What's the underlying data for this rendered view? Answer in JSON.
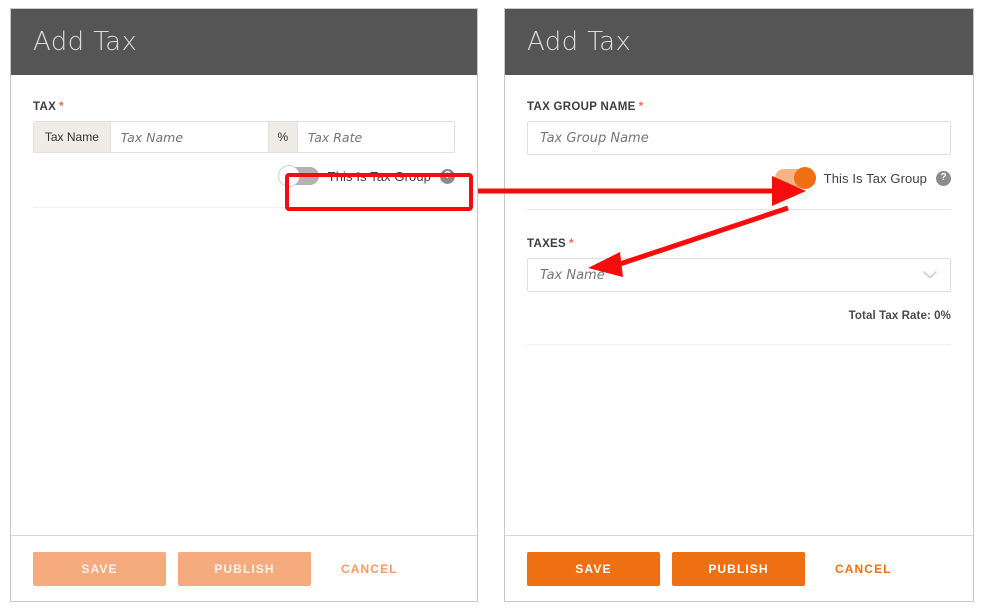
{
  "panels": {
    "left": {
      "title": "Add Tax",
      "tax_label": "TAX",
      "required_mark": "*",
      "tax_name_addon": "Tax Name",
      "tax_name_placeholder": "Tax Name",
      "percent_addon": "%",
      "tax_rate_placeholder": "Tax Rate",
      "toggle_label": "This Is Tax Group",
      "toggle_state": "off",
      "help_glyph": "?",
      "footer": {
        "save_label": "SAVE",
        "publish_label": "PUBLISH",
        "cancel_label": "CANCEL",
        "style": "muted"
      }
    },
    "right": {
      "title": "Add Tax",
      "tax_group_name_label": "TAX GROUP NAME",
      "required_mark": "*",
      "tax_group_name_placeholder": "Tax Group Name",
      "toggle_label": "This Is Tax Group",
      "toggle_state": "on",
      "help_glyph": "?",
      "taxes_label": "TAXES",
      "taxes_placeholder": "Tax Name",
      "taxes_dropdown_icon": "chevron-down-icon",
      "total_tax_rate": "Total Tax Rate: 0%",
      "footer": {
        "save_label": "SAVE",
        "publish_label": "PUBLISH",
        "cancel_label": "CANCEL",
        "style": "solid"
      }
    }
  },
  "annotations": {
    "highlight_box": "toggle-off-highlight",
    "arrow_1": "arrow-to-toggle-on",
    "arrow_2": "arrow-to-taxes-field",
    "color": "#f50d0d"
  },
  "colors": {
    "header_bg": "#555555",
    "accent": "#ef7012",
    "accent_muted": "#f6ab7e",
    "required": "#f4665a",
    "annotation": "#f50d0d",
    "toggle_off_track": "#b6b3ae",
    "toggle_on_track": "#f8b384"
  }
}
